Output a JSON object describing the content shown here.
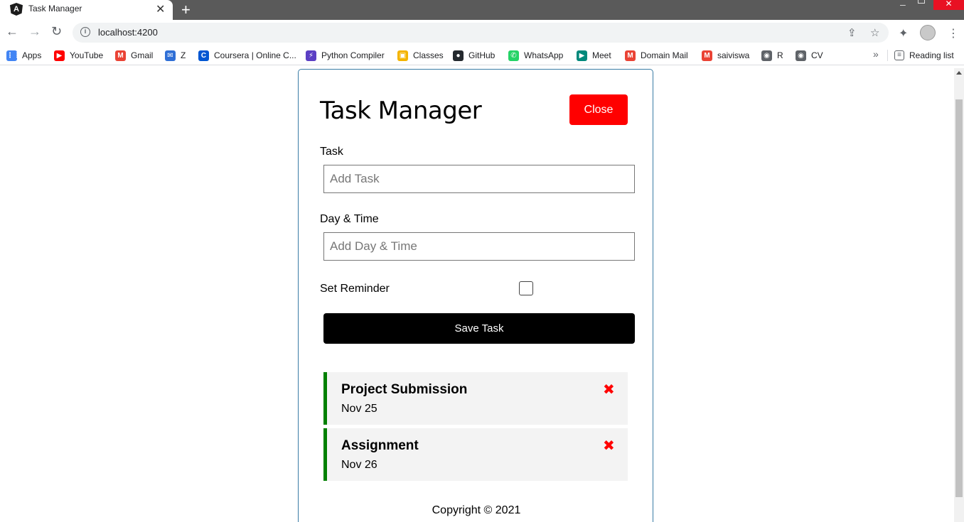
{
  "browser": {
    "tab_title": "Task Manager",
    "url": "localhost:4200",
    "bookmarks": [
      {
        "label": "Apps",
        "icon": "apps-grid-icon",
        "color": "#4285f4"
      },
      {
        "label": "YouTube",
        "icon": "youtube-icon",
        "color": "#ff0000"
      },
      {
        "label": "Gmail",
        "icon": "gmail-icon",
        "color": "#ea4335"
      },
      {
        "label": "Z",
        "icon": "z-icon",
        "color": "#2f6fd6"
      },
      {
        "label": "Coursera | Online C...",
        "icon": "coursera-icon",
        "color": "#0056d2"
      },
      {
        "label": "Python Compiler",
        "icon": "python-compiler-icon",
        "color": "#5b3fc4"
      },
      {
        "label": "Classes",
        "icon": "classroom-icon",
        "color": "#f4b400"
      },
      {
        "label": "GitHub",
        "icon": "github-icon",
        "color": "#24292e"
      },
      {
        "label": "WhatsApp",
        "icon": "whatsapp-icon",
        "color": "#25d366"
      },
      {
        "label": "Meet",
        "icon": "meet-icon",
        "color": "#00897b"
      },
      {
        "label": "Domain Mail",
        "icon": "gmail-icon",
        "color": "#ea4335"
      },
      {
        "label": "saiviswa",
        "icon": "gmail-icon",
        "color": "#ea4335"
      },
      {
        "label": "R",
        "icon": "globe-icon",
        "color": "#5f6368"
      },
      {
        "label": "CV",
        "icon": "globe-icon",
        "color": "#5f6368"
      }
    ],
    "reading_list": "Reading list"
  },
  "app": {
    "title": "Task Manager",
    "close_label": "Close",
    "task_label": "Task",
    "task_placeholder": "Add Task",
    "daytime_label": "Day & Time",
    "daytime_placeholder": "Add Day & Time",
    "reminder_label": "Set Reminder",
    "save_label": "Save Task",
    "tasks": [
      {
        "name": "Project Submission",
        "date": "Nov 25"
      },
      {
        "name": "Assignment",
        "date": "Nov 26"
      }
    ],
    "footer": "Copyright © 2021",
    "colors": {
      "close": "#ff0000",
      "save": "#000000",
      "reminder_border": "#008000",
      "delete": "#ff0000"
    }
  }
}
